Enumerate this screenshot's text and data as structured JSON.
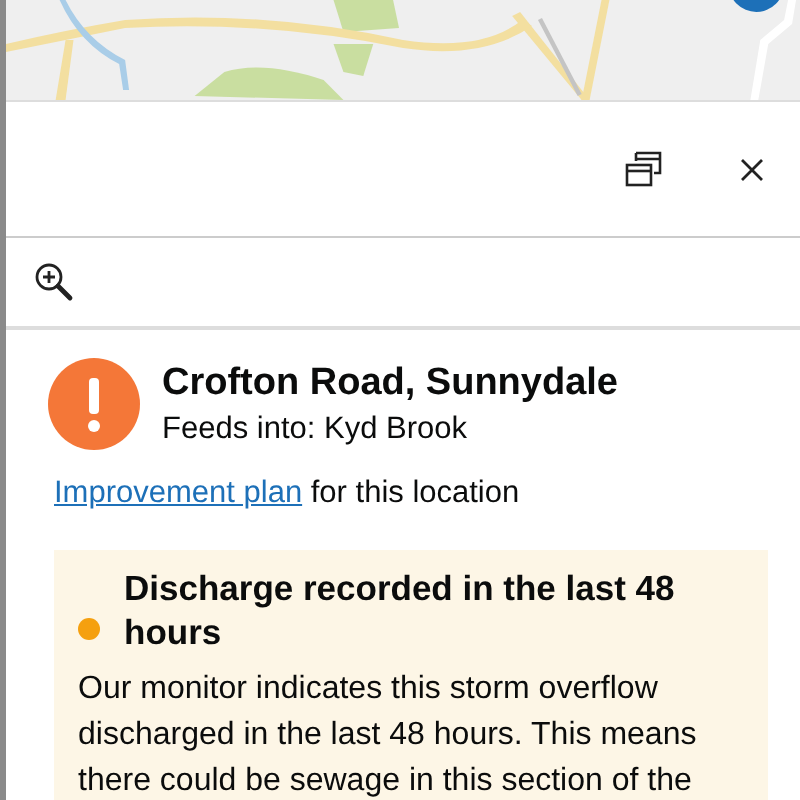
{
  "toolbar": {
    "buttons": [
      {
        "kind": "popout"
      },
      {
        "kind": "close"
      }
    ]
  },
  "zoom_button": {
    "kind": "zoom-in"
  },
  "location": {
    "kind": "alert",
    "title": "Crofton Road, Sunnydale",
    "subtitle": "Feeds into: Kyd Brook"
  },
  "improvement": {
    "link": "Improvement plan",
    "text": "for this location"
  },
  "notice": {
    "color": "#f5a00f",
    "title": "Discharge recorded in the last 48 hours",
    "body": "Our monitor indicates this storm overflow discharged in the last 48 hours. This means there could be sewage in this section of the"
  }
}
